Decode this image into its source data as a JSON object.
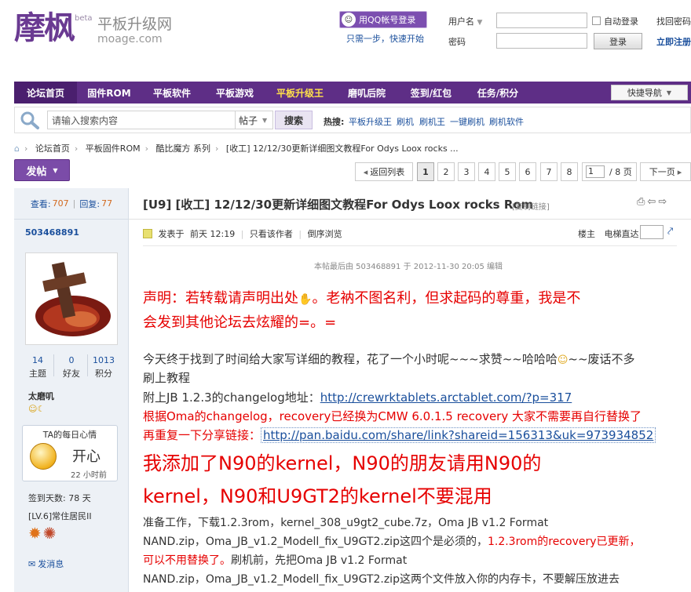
{
  "header": {
    "logo_text": "摩枫",
    "logo_beta": "beta",
    "logo_subtitle": "平板升级网",
    "logo_url": "moage.com",
    "qq_login": "用QQ帐号登录",
    "qq_tip": "只需一步，快速开始",
    "username_label": "用户名",
    "password_label": "密码",
    "auto_login": "自动登录",
    "login_button": "登录",
    "forgot_password": "找回密码",
    "register": "立即注册"
  },
  "nav": {
    "items": [
      "论坛首页",
      "固件ROM",
      "平板软件",
      "平板游戏",
      "平板升级王",
      "磨叽后院",
      "签到/红包",
      "任务/积分"
    ],
    "quick": "快捷导航"
  },
  "search": {
    "placeholder": "请输入搜索内容",
    "type": "帖子",
    "button": "搜索",
    "hot_label": "热搜:",
    "hot_items": [
      "平板升级王",
      "刷机",
      "刷机王",
      "一键刷机",
      "刷机软件"
    ]
  },
  "breadcrumb": [
    "论坛首页",
    "平板固件ROM",
    "酷比魔方 系列",
    "[收工] 12/12/30更新详细图文教程For Odys Loox rocks ..."
  ],
  "actions": {
    "post_button": "发帖",
    "back_list": "返回列表",
    "pages": [
      "1",
      "2",
      "3",
      "4",
      "5",
      "6",
      "7",
      "8"
    ],
    "current_page": "1",
    "total_pages": "/ 8 页",
    "next": "下一页"
  },
  "sidebar": {
    "views_label": "查看:",
    "views": "707",
    "replies_label": "回复:",
    "replies": "77",
    "author": "503468891",
    "stats": [
      {
        "value": "14",
        "label": "主题"
      },
      {
        "value": "0",
        "label": "好友"
      },
      {
        "value": "1013",
        "label": "积分"
      }
    ],
    "group": "太磨叽",
    "mood_title": "TA的每日心情",
    "mood": "开心",
    "mood_time": "22 小时前",
    "sign_days": "签到天数: 78 天",
    "level": "[LV.6]常住居民II",
    "send_pm": "发消息"
  },
  "post": {
    "title": "[U9] [收工] 12/12/30更新详细图文教程For Odys Loox rocks Rom",
    "copy_link": "[复制链接]",
    "posted_prefix": "发表于",
    "posted_time": "前天 12:19",
    "only_author": "只看该作者",
    "reverse": "倒序浏览",
    "floor": "楼主",
    "elevator": "电梯直达",
    "last_edit": "本帖最后由 503468891 于 2012-11-30 20:05 编辑",
    "decl_line1": "声明：若转载请声明出处",
    "decl_line1b": "。老衲不图名利，但求起码的尊重，我是不",
    "decl_line2": "会发到其他论坛去炫耀的=。=",
    "p1_line1a": "今天终于找到了时间给大家写详细的教程，花了一个小时呢~~~求赞~~哈哈哈",
    "p1_line1b": "~~废话不多",
    "p1_line2": "刷上教程",
    "changelog_prefix": "附上JB 1.2.3的changelog地址：",
    "changelog_url": "http://crewrktablets.arctablet.com/?p=317",
    "recovery_note": "根据Oma的changelog，recovery已经换为CMW 6.0.1.5 recovery 大家不需要再自行替换了",
    "share_prefix": "再重复一下分享链接：",
    "share_url": "http://pan.baidu.com/share/link?shareid=156313&uk=973934852",
    "kernel_line1": "我添加了N90的kernel，N90的朋友请用N90的",
    "kernel_line2": "kernel，N90和U9GT2的kernel不要混用",
    "prep_line1": "准备工作，下载1.2.3rom，kernel_308_u9gt2_cube.7z，Oma JB v1.2 Format",
    "prep_line2a": "NAND.zip，Oma_JB_v1.2_Modell_fix_U9GT2.zip这四个是必须的，",
    "prep_line2b": "1.2.3rom的recovery已更新，",
    "prep_line3a": "可以不用替换了。",
    "prep_line3b": "刷机前，先把Oma JB v1.2 Format",
    "prep_line4": "NAND.zip，Oma_JB_v1.2_Modell_fix_U9GT2.zip这两个文件放入你的内存卡，不要解压放进去"
  },
  "colors": {
    "brand": "#6a3a92",
    "nav_bg": "#5e2e86",
    "highlight_red": "#e60000",
    "link_blue": "#1a4f9c"
  }
}
